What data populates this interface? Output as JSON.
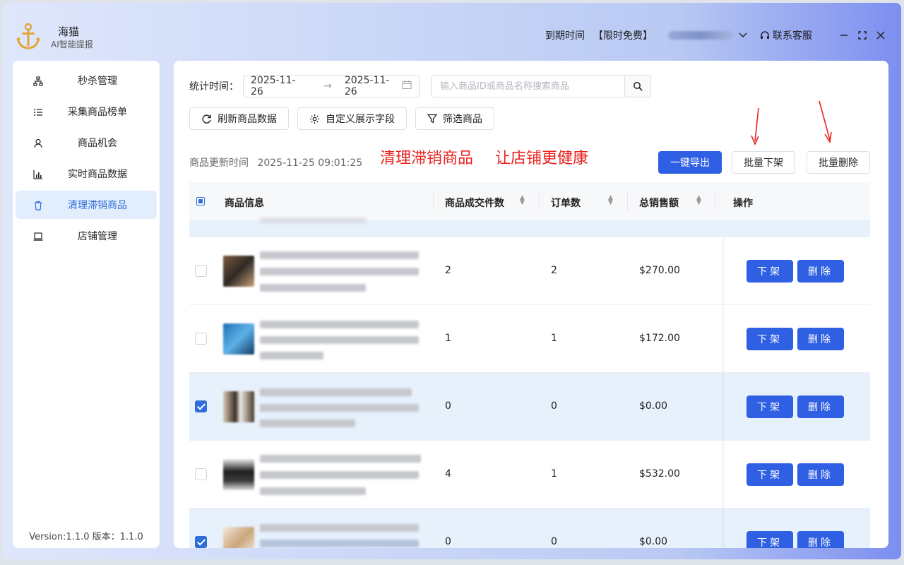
{
  "app": {
    "name": "海猫",
    "subtitle": "AI智能提报"
  },
  "topbar": {
    "expire_label": "到期时间",
    "free_label": "【限时免费】",
    "service_label": "联系客服"
  },
  "sidebar": {
    "items": [
      {
        "label": "秒杀管理",
        "icon": "sitemap-icon"
      },
      {
        "label": "采集商品榜单",
        "icon": "list-icon"
      },
      {
        "label": "商品机会",
        "icon": "user-icon"
      },
      {
        "label": "实时商品数据",
        "icon": "bar-chart-icon"
      },
      {
        "label": "清理滞销商品",
        "icon": "trash-icon",
        "active": true
      },
      {
        "label": "店铺管理",
        "icon": "laptop-icon"
      }
    ],
    "version": "Version:1.1.0   版本：1.1.0"
  },
  "filters": {
    "date_label": "统计时间：",
    "date_start": "2025-11-26",
    "date_arrow": "→",
    "date_end": "2025-11-26",
    "search_placeholder": "输入商品ID或商品名称搜索商品"
  },
  "toolbar": {
    "refresh": "刷新商品数据",
    "custom_fields": "自定义展示字段",
    "filter": "筛选商品"
  },
  "update": {
    "label": "商品更新时间",
    "time": "2025-11-25 09:01:25"
  },
  "slogan": {
    "part1": "清理滞销商品",
    "part2": "让店铺更健康"
  },
  "actions": {
    "export": "一键导出",
    "bulk_delist": "批量下架",
    "bulk_delete": "批量删除"
  },
  "table": {
    "headers": {
      "info": "商品信息",
      "units_sold": "商品成交件数",
      "orders": "订单数",
      "total_sales": "总销售额",
      "ops": "操作"
    },
    "op_delist": "下架",
    "op_delete": "删除",
    "rows": [
      {
        "units": "2",
        "orders": "2",
        "sales": "$270.00",
        "checked": false
      },
      {
        "units": "1",
        "orders": "1",
        "sales": "$172.00",
        "checked": false
      },
      {
        "units": "0",
        "orders": "0",
        "sales": "$0.00",
        "checked": true
      },
      {
        "units": "4",
        "orders": "1",
        "sales": "$532.00",
        "checked": false
      },
      {
        "units": "0",
        "orders": "0",
        "sales": "$0.00",
        "checked": true
      }
    ]
  },
  "colors": {
    "primary": "#2f5fe3",
    "active_bg": "#e3eefc",
    "selected_row": "#e6f1fb",
    "slogan": "#e8221f"
  }
}
